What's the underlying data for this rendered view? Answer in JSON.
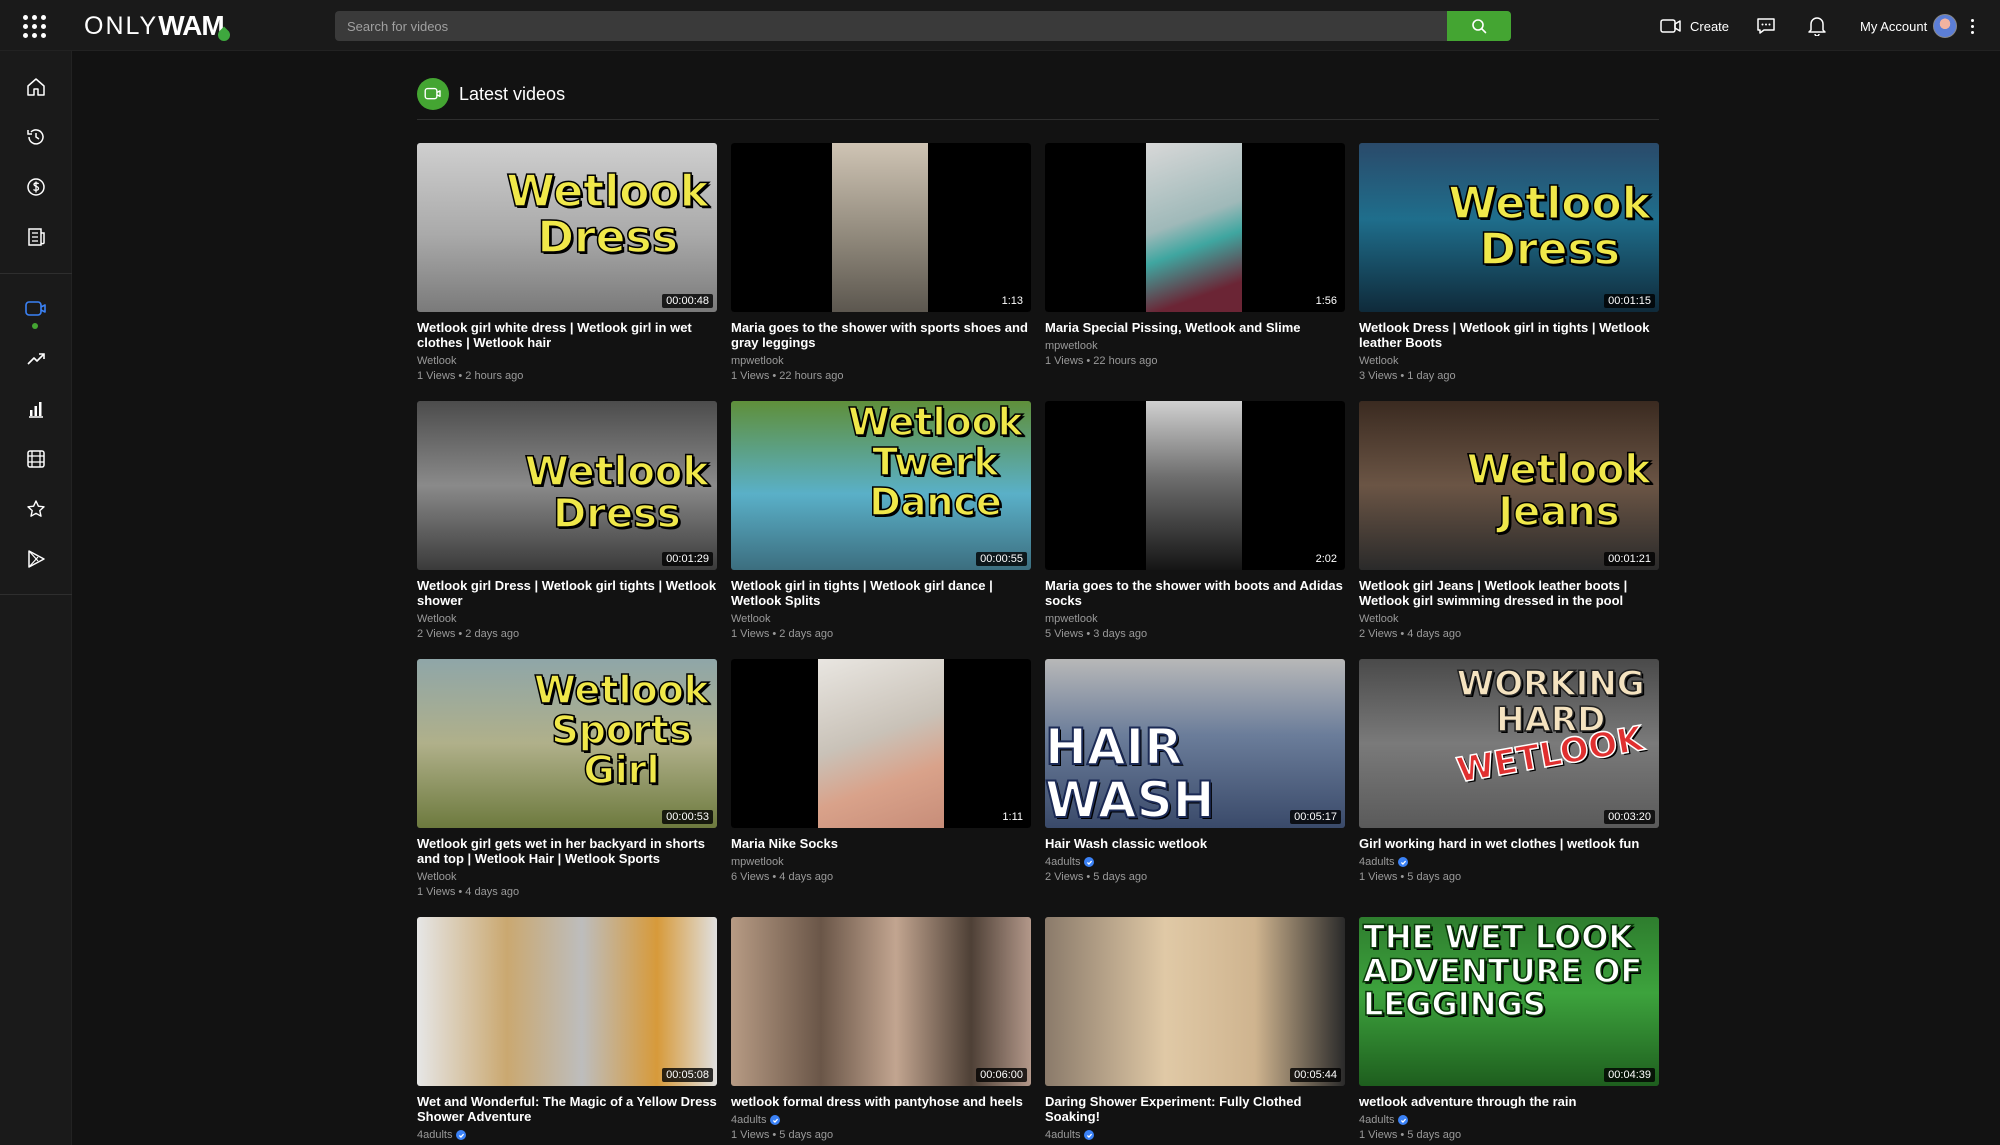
{
  "header": {
    "logo_thin": "ONLY",
    "logo_bold": "WAM",
    "search_placeholder": "Search for videos",
    "create_label": "Create",
    "account_label": "My Account"
  },
  "section": {
    "title": "Latest videos"
  },
  "colors": {
    "accent": "#44a532",
    "background": "#121212",
    "panel": "#1a1a1a"
  },
  "videos": [
    {
      "title": "Wetlook girl white dress | Wetlook girl in wet clothes | Wetlook hair",
      "channel": "Wetlook",
      "meta": "1 Views • 2 hours ago",
      "duration": "00:00:48",
      "overlay": [
        "Wetlook",
        "Dress"
      ],
      "verified": false
    },
    {
      "title": "Maria goes to the shower with sports shoes and gray leggings",
      "channel": "mpwetlook",
      "meta": "1 Views • 22 hours ago",
      "duration": "1:13",
      "overlay": [],
      "verified": false
    },
    {
      "title": "Maria Special Pissing, Wetlook and Slime",
      "channel": "mpwetlook",
      "meta": "1 Views • 22 hours ago",
      "duration": "1:56",
      "overlay": [],
      "verified": false
    },
    {
      "title": "Wetlook Dress | Wetlook girl in tights | Wetlook leather Boots",
      "channel": "Wetlook",
      "meta": "3 Views • 1 day ago",
      "duration": "00:01:15",
      "overlay": [
        "Wetlook",
        "Dress"
      ],
      "verified": false
    },
    {
      "title": "Wetlook girl Dress | Wetlook girl tights | Wetlook shower",
      "channel": "Wetlook",
      "meta": "2 Views • 2 days ago",
      "duration": "00:01:29",
      "overlay": [
        "Wetlook",
        "Dress"
      ],
      "verified": false
    },
    {
      "title": "Wetlook girl in tights | Wetlook girl dance | Wetlook Splits",
      "channel": "Wetlook",
      "meta": "1 Views • 2 days ago",
      "duration": "00:00:55",
      "overlay": [
        "Wetlook",
        "Twerk",
        "Dance"
      ],
      "verified": false
    },
    {
      "title": "Maria goes to the shower with boots and Adidas socks",
      "channel": "mpwetlook",
      "meta": "5 Views • 3 days ago",
      "duration": "2:02",
      "overlay": [],
      "verified": false
    },
    {
      "title": "Wetlook girl Jeans | Wetlook leather boots | Wetlook girl swimming dressed in the pool",
      "channel": "Wetlook",
      "meta": "2 Views • 4 days ago",
      "duration": "00:01:21",
      "overlay": [
        "Wetlook",
        "Jeans"
      ],
      "verified": false
    },
    {
      "title": "Wetlook girl gets wet in her backyard in shorts and top | Wetlook Hair | Wetlook Sports",
      "channel": "Wetlook",
      "meta": "1 Views • 4 days ago",
      "duration": "00:00:53",
      "overlay": [
        "Wetlook",
        "Sports",
        "Girl"
      ],
      "verified": false
    },
    {
      "title": "Maria Nike Socks",
      "channel": "mpwetlook",
      "meta": "6 Views • 4 days ago",
      "duration": "1:11",
      "overlay": [],
      "verified": false
    },
    {
      "title": "Hair Wash classic wetlook",
      "channel": "4adults",
      "meta": "2 Views • 5 days ago",
      "duration": "00:05:17",
      "overlay": [
        "HAIR WASH"
      ],
      "verified": true
    },
    {
      "title": "Girl working hard in wet clothes | wetlook fun",
      "channel": "4adults",
      "meta": "1 Views • 5 days ago",
      "duration": "00:03:20",
      "overlay": [
        "WORKING",
        "HARD",
        "WETLOOK"
      ],
      "verified": true
    },
    {
      "title": "Wet and Wonderful: The Magic of a Yellow Dress Shower Adventure",
      "channel": "4adults",
      "meta": "",
      "duration": "00:05:08",
      "overlay": [],
      "verified": true
    },
    {
      "title": "wetlook formal dress with pantyhose and heels",
      "channel": "4adults",
      "meta": "1 Views • 5 days ago",
      "duration": "00:06:00",
      "overlay": [],
      "verified": true
    },
    {
      "title": "Daring Shower Experiment: Fully Clothed Soaking!",
      "channel": "4adults",
      "meta": "1 Views • 5 days ago",
      "duration": "00:05:44",
      "overlay": [],
      "verified": true
    },
    {
      "title": "wetlook adventure through the rain",
      "channel": "4adults",
      "meta": "1 Views • 5 days ago",
      "duration": "00:04:39",
      "overlay": [
        "THE WET LOOK",
        "ADVENTURE OF",
        "LEGGINGS"
      ],
      "verified": true
    }
  ]
}
